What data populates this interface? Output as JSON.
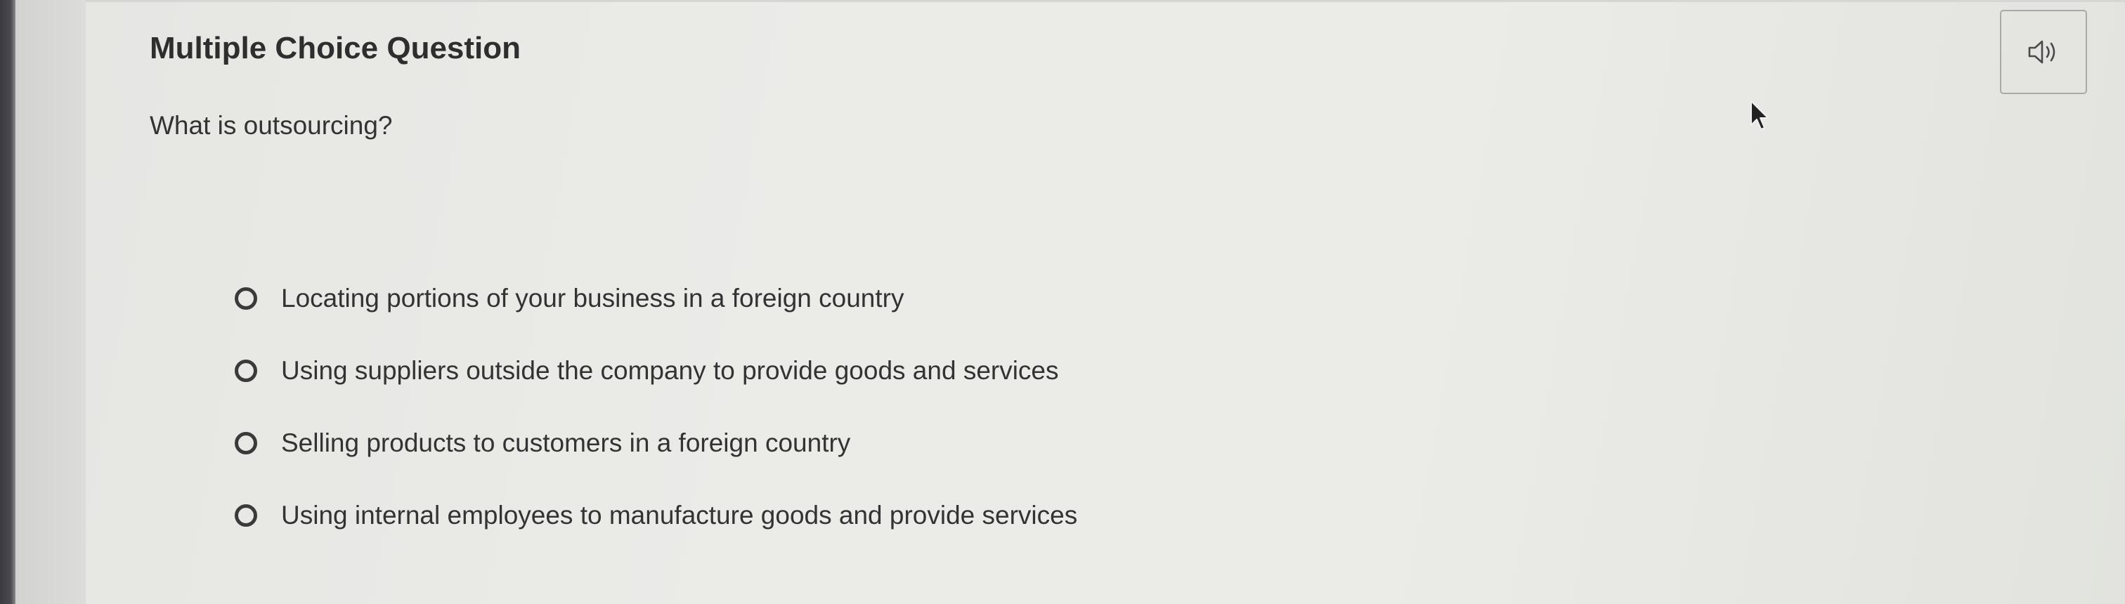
{
  "question": {
    "title": "Multiple Choice Question",
    "prompt": "What is outsourcing?",
    "options": [
      {
        "label": "Locating portions of your business in a foreign country",
        "selected": false
      },
      {
        "label": "Using suppliers outside the company to provide goods and services",
        "selected": false
      },
      {
        "label": "Selling products to customers in a foreign country",
        "selected": false
      },
      {
        "label": "Using internal employees to manufacture goods and provide services",
        "selected": false
      }
    ]
  },
  "toolbar": {
    "audio_icon": "speaker-icon"
  }
}
